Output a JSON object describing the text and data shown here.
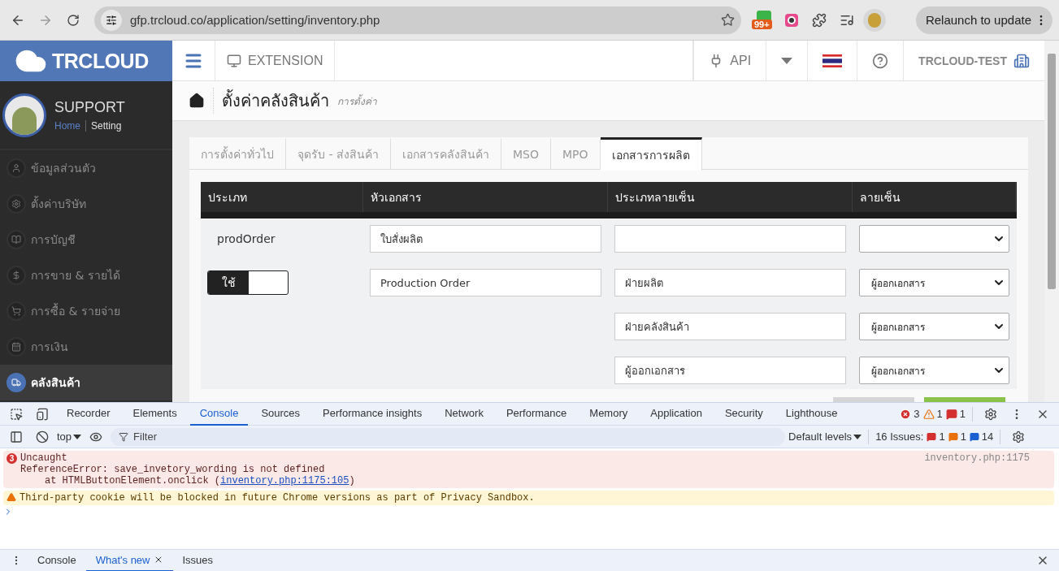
{
  "browser": {
    "url": "gfp.trcloud.co/application/setting/inventory.php",
    "extension_badge": "99+",
    "relaunch": "Relaunch to update"
  },
  "app": {
    "logo": "TRCLOUD",
    "topbar": {
      "extension": "EXTENSION",
      "api": "API",
      "company": "TRCLOUD-TEST"
    }
  },
  "profile": {
    "name": "SUPPORT",
    "breadcrumb": [
      {
        "label": "Home",
        "link": true
      },
      {
        "label": "Setting",
        "link": false
      }
    ]
  },
  "sidebar": {
    "items": [
      {
        "label": "ข้อมูลส่วนตัว",
        "selected": false
      },
      {
        "label": "ตั้งค่าบริษัท",
        "selected": false
      },
      {
        "label": "การบัญชี",
        "selected": false
      },
      {
        "label": "การขาย & รายได้",
        "selected": false
      },
      {
        "label": "การซื้อ & รายจ่าย",
        "selected": false
      },
      {
        "label": "การเงิน",
        "selected": false
      },
      {
        "label": "คลังสินค้า",
        "selected": true
      }
    ]
  },
  "page": {
    "title": "ตั้งค่าคลังสินค้า",
    "subtitle": "การตั้งค่า"
  },
  "tabs": [
    {
      "label": "การตั้งค่าทั่วไป",
      "selected": false
    },
    {
      "label": "จุดรับ - ส่งสินค้า",
      "selected": false
    },
    {
      "label": "เอกสารคลังสินค้า",
      "selected": false
    },
    {
      "label": "MSO",
      "selected": false
    },
    {
      "label": "MPO",
      "selected": false
    },
    {
      "label": "เอกสารการผลิต",
      "selected": true
    }
  ],
  "table": {
    "columns": [
      "ประเภท",
      "หัวเอกสาร",
      "ประเภทลายเซ็น",
      "ลายเซ็น"
    ],
    "rows": [
      {
        "type": {
          "kind": "text",
          "label": "prodOrder"
        },
        "title": "ใบสั่งผลิต"
      },
      {
        "type": {
          "kind": "toggle",
          "label": "ใช้",
          "on": true
        },
        "title": "Production Order",
        "signature_type": "ฝ่ายผลิต",
        "signature": "ผู้ออกเอกสาร"
      },
      {
        "signature_type": "ฝ่ายคลังสินค้า",
        "signature": "ผู้ออกเอกสาร"
      },
      {
        "signature_type": "ผู้ออกเอกสาร",
        "signature": "ผู้ออกเอกสาร"
      }
    ]
  },
  "devtools": {
    "tabs": [
      {
        "label": "Recorder",
        "selected": false
      },
      {
        "label": "Elements",
        "selected": false
      },
      {
        "label": "Console",
        "selected": true
      },
      {
        "label": "Sources",
        "selected": false
      },
      {
        "label": "Performance insights",
        "selected": false
      },
      {
        "label": "Network",
        "selected": false
      },
      {
        "label": "Performance",
        "selected": false
      },
      {
        "label": "Memory",
        "selected": false
      },
      {
        "label": "Application",
        "selected": false
      },
      {
        "label": "Security",
        "selected": false
      },
      {
        "label": "Lighthouse",
        "selected": false
      }
    ],
    "counts": {
      "errors": "3",
      "warnings": "1",
      "issues": "1"
    },
    "context": "top",
    "filter_placeholder": "Filter",
    "levels": "Default levels",
    "issues": {
      "label": "16 Issues:",
      "errors": "1",
      "warnings": "1",
      "info": "14"
    },
    "messages": [
      {
        "kind": "error",
        "count": "3",
        "lines": [
          "Uncaught",
          "ReferenceError: save_invetory_wording is not defined"
        ],
        "trace": "at HTMLButtonElement.onclick (",
        "link": "inventory.php:1175:105",
        "trace_end": ")",
        "source": "inventory.php:1175"
      },
      {
        "kind": "warning",
        "text": "Third-party cookie will be blocked in future Chrome versions as part of Privacy Sandbox."
      }
    ],
    "drawer_tabs": [
      {
        "label": "Console",
        "selected": false,
        "closable": false
      },
      {
        "label": "What's new",
        "selected": true,
        "closable": true
      },
      {
        "label": "Issues",
        "selected": false,
        "closable": false
      }
    ]
  }
}
